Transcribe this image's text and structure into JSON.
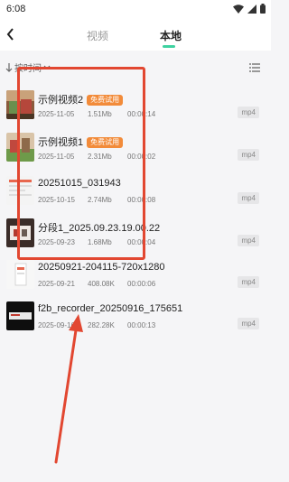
{
  "status": {
    "time": "6:08"
  },
  "header": {
    "tabs": [
      {
        "label": "视频"
      },
      {
        "label": "本地"
      }
    ]
  },
  "toolbar": {
    "sort_label": "按时间"
  },
  "files": [
    {
      "name": "示例视频2",
      "badge": "免费试用",
      "date": "2025-11-05",
      "size": "1.51Mb",
      "duration": "00:00:14",
      "format": "mp4"
    },
    {
      "name": "示例视频1",
      "badge": "免费试用",
      "date": "2025-11-05",
      "size": "2.31Mb",
      "duration": "00:00:02",
      "format": "mp4"
    },
    {
      "name": "20251015_031943",
      "date": "2025-10-15",
      "size": "2.74Mb",
      "duration": "00:00:08",
      "format": "mp4"
    },
    {
      "name": "分段1_2025.09.23.19.00.22",
      "date": "2025-09-23",
      "size": "1.68Mb",
      "duration": "00:00:04",
      "format": "mp4"
    },
    {
      "name": "20250921-204115-720x1280",
      "date": "2025-09-21",
      "size": "408.08K",
      "duration": "00:00:06",
      "format": "mp4"
    },
    {
      "name": "f2b_recorder_20250916_175651",
      "date": "2025-09-16",
      "size": "282.28K",
      "duration": "00:00:13",
      "format": "mp4"
    }
  ],
  "colors": {
    "accent": "#3ed2a0",
    "badge": "#f28b3a",
    "annotation": "#e24731"
  }
}
